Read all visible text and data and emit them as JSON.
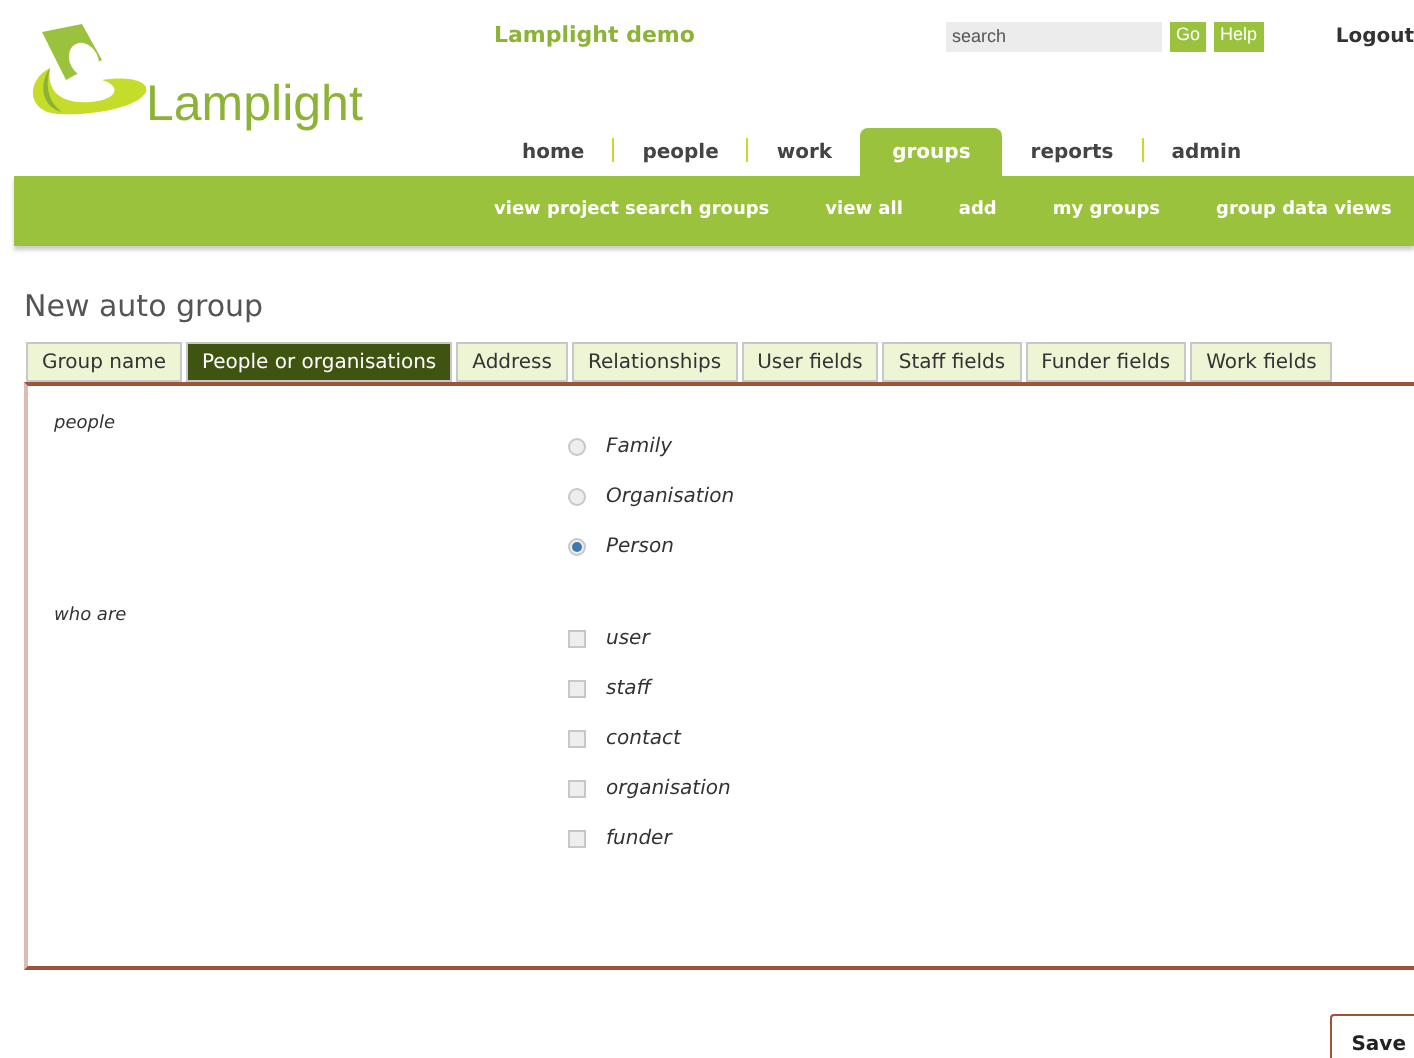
{
  "header": {
    "logo_text": "Lamplight",
    "site_title": "Lamplight demo",
    "search": {
      "placeholder": "search"
    },
    "buttons": [
      "Go",
      "Help"
    ],
    "logout": "Logout"
  },
  "nav": [
    {
      "label": "home",
      "selected": false
    },
    {
      "label": "people",
      "selected": false
    },
    {
      "label": "work",
      "selected": false
    },
    {
      "label": "groups",
      "selected": true
    },
    {
      "label": "reports",
      "selected": false
    },
    {
      "label": "admin",
      "selected": false
    }
  ],
  "subnav": [
    "view project search groups",
    "view all",
    "add",
    "my groups",
    "group data views"
  ],
  "page_title": "New auto group",
  "tabs": [
    {
      "label": "Group name",
      "selected": false
    },
    {
      "label": "People or organisations",
      "selected": true
    },
    {
      "label": "Address",
      "selected": false
    },
    {
      "label": "Relationships",
      "selected": false
    },
    {
      "label": "User fields",
      "selected": false
    },
    {
      "label": "Staff fields",
      "selected": false
    },
    {
      "label": "Funder fields",
      "selected": false
    },
    {
      "label": "Work fields",
      "selected": false
    }
  ],
  "sections": [
    {
      "label": "people",
      "kind": "radio",
      "options": [
        {
          "label": "Family",
          "selected": false
        },
        {
          "label": "Organisation",
          "selected": false
        },
        {
          "label": "Person",
          "selected": true
        }
      ]
    },
    {
      "label": "who are",
      "kind": "checkbox",
      "options": [
        {
          "label": "user",
          "checked": false
        },
        {
          "label": "staff",
          "checked": false
        },
        {
          "label": "contact",
          "checked": false
        },
        {
          "label": "organisation",
          "checked": false
        },
        {
          "label": "funder",
          "checked": false
        }
      ]
    }
  ],
  "save_button": "Save"
}
